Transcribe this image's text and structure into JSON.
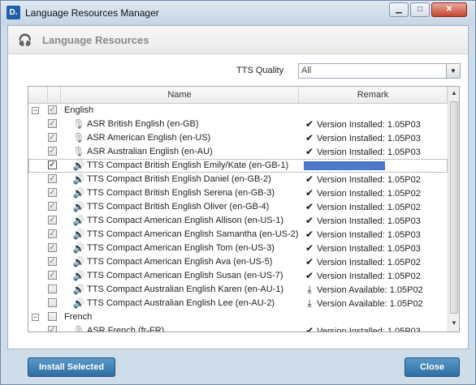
{
  "window": {
    "title": "Language Resources Manager",
    "app_icon_text": "D."
  },
  "header": {
    "title": "Language Resources"
  },
  "filter": {
    "label": "TTS Quality",
    "value": "All"
  },
  "grid": {
    "columns": {
      "name": "Name",
      "remark": "Remark"
    },
    "rows": [
      {
        "kind": "group",
        "label": "English",
        "expander": "−"
      },
      {
        "kind": "item",
        "icon": "microphone-icon",
        "glyph": "🎙",
        "name": "ASR British English (en-GB)",
        "remark_icon": "check-icon",
        "remark_glyph": "✔",
        "remark": "Version Installed: 1.05P03"
      },
      {
        "kind": "item",
        "icon": "microphone-icon",
        "glyph": "🎙",
        "name": "ASR American English (en-US)",
        "remark_icon": "check-icon",
        "remark_glyph": "✔",
        "remark": "Version Installed: 1.05P03"
      },
      {
        "kind": "item",
        "icon": "microphone-icon",
        "glyph": "🎙",
        "name": "ASR Australian English (en-AU)",
        "remark_icon": "check-icon",
        "remark_glyph": "✔",
        "remark": "Version Installed: 1.05P03"
      },
      {
        "kind": "item",
        "selected": true,
        "icon": "speaker-icon",
        "glyph": "🔊",
        "name": "TTS Compact British English Emily/Kate (en-GB-1)",
        "remark_icon": "",
        "remark_glyph": "",
        "remark": ""
      },
      {
        "kind": "item",
        "icon": "speaker-icon",
        "glyph": "🔊",
        "name": "TTS Compact British English Daniel (en-GB-2)",
        "remark_icon": "check-icon",
        "remark_glyph": "✔",
        "remark": "Version Installed: 1.05P02"
      },
      {
        "kind": "item",
        "icon": "speaker-icon",
        "glyph": "🔊",
        "name": "TTS Compact British English Serena (en-GB-3)",
        "remark_icon": "check-icon",
        "remark_glyph": "✔",
        "remark": "Version Installed: 1.05P02"
      },
      {
        "kind": "item",
        "icon": "speaker-icon",
        "glyph": "🔊",
        "name": "TTS Compact British English Oliver (en-GB-4)",
        "remark_icon": "check-icon",
        "remark_glyph": "✔",
        "remark": "Version Installed: 1.05P02"
      },
      {
        "kind": "item",
        "icon": "speaker-icon",
        "glyph": "🔊",
        "name": "TTS Compact American English Allison (en-US-1)",
        "remark_icon": "check-icon",
        "remark_glyph": "✔",
        "remark": "Version Installed: 1.05P03"
      },
      {
        "kind": "item",
        "icon": "speaker-icon",
        "glyph": "🔊",
        "name": "TTS Compact American English Samantha (en-US-2)",
        "remark_icon": "check-icon",
        "remark_glyph": "✔",
        "remark": "Version Installed: 1.05P03"
      },
      {
        "kind": "item",
        "icon": "speaker-icon",
        "glyph": "🔊",
        "name": "TTS Compact American English Tom (en-US-3)",
        "remark_icon": "check-icon",
        "remark_glyph": "✔",
        "remark": "Version Installed: 1.05P03"
      },
      {
        "kind": "item",
        "icon": "speaker-icon",
        "glyph": "🔊",
        "name": "TTS Compact American English Ava (en-US-5)",
        "remark_icon": "check-icon",
        "remark_glyph": "✔",
        "remark": "Version Installed: 1.05P02"
      },
      {
        "kind": "item",
        "icon": "speaker-icon",
        "glyph": "🔊",
        "name": "TTS Compact American English Susan (en-US-7)",
        "remark_icon": "check-icon",
        "remark_glyph": "✔",
        "remark": "Version Installed: 1.05P02"
      },
      {
        "kind": "item",
        "unchecked": true,
        "icon": "speaker-icon",
        "glyph": "🔊",
        "name": "TTS Compact Australian English Karen (en-AU-1)",
        "remark_icon": "download-icon",
        "remark_glyph": "⤓",
        "remark": "Version Available: 1.05P02"
      },
      {
        "kind": "item",
        "unchecked": true,
        "icon": "speaker-icon",
        "glyph": "🔊",
        "name": "TTS Compact Australian English Lee (en-AU-2)",
        "remark_icon": "download-icon",
        "remark_glyph": "⤓",
        "remark": "Version Available: 1.05P02"
      },
      {
        "kind": "group",
        "label": "French",
        "expander": "−",
        "unchecked": true
      },
      {
        "kind": "item",
        "icon": "microphone-icon",
        "glyph": "🎙",
        "name": "ASR French (fr-FR)",
        "remark_icon": "check-icon",
        "remark_glyph": "✔",
        "remark": "Version Installed: 1.05P03"
      }
    ]
  },
  "buttons": {
    "install": "Install Selected",
    "close": "Close"
  }
}
